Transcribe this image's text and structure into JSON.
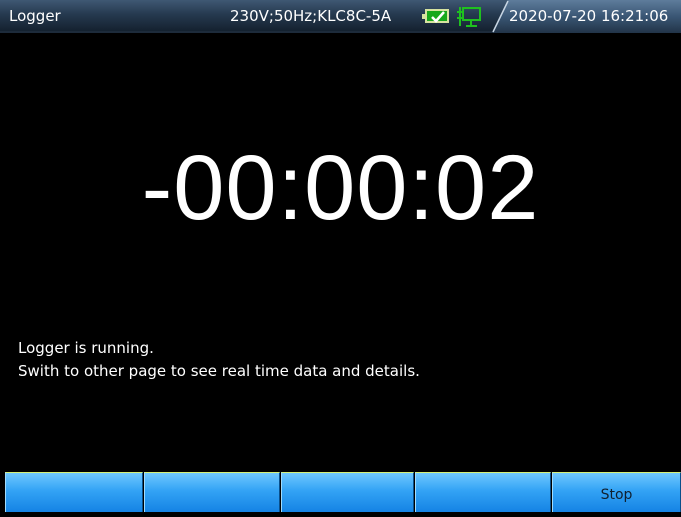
{
  "header": {
    "title": "Logger",
    "device_info": "230V;50Hz;KLC8C-5A",
    "datetime": "2020-07-20 16:21:06",
    "battery_icon": "battery-charging-icon",
    "network_icon": "network-connected-icon"
  },
  "main": {
    "timer": "-00:00:02",
    "status_line1": "Logger is running.",
    "status_line2": "Swith to other page to see real time data and details."
  },
  "softkeys": {
    "f1": "",
    "f2": "",
    "f3": "",
    "f4": "",
    "f5": "Stop"
  },
  "colors": {
    "background": "#000000",
    "softkey": "#33a3f5",
    "battery_fill": "#18a81c"
  }
}
